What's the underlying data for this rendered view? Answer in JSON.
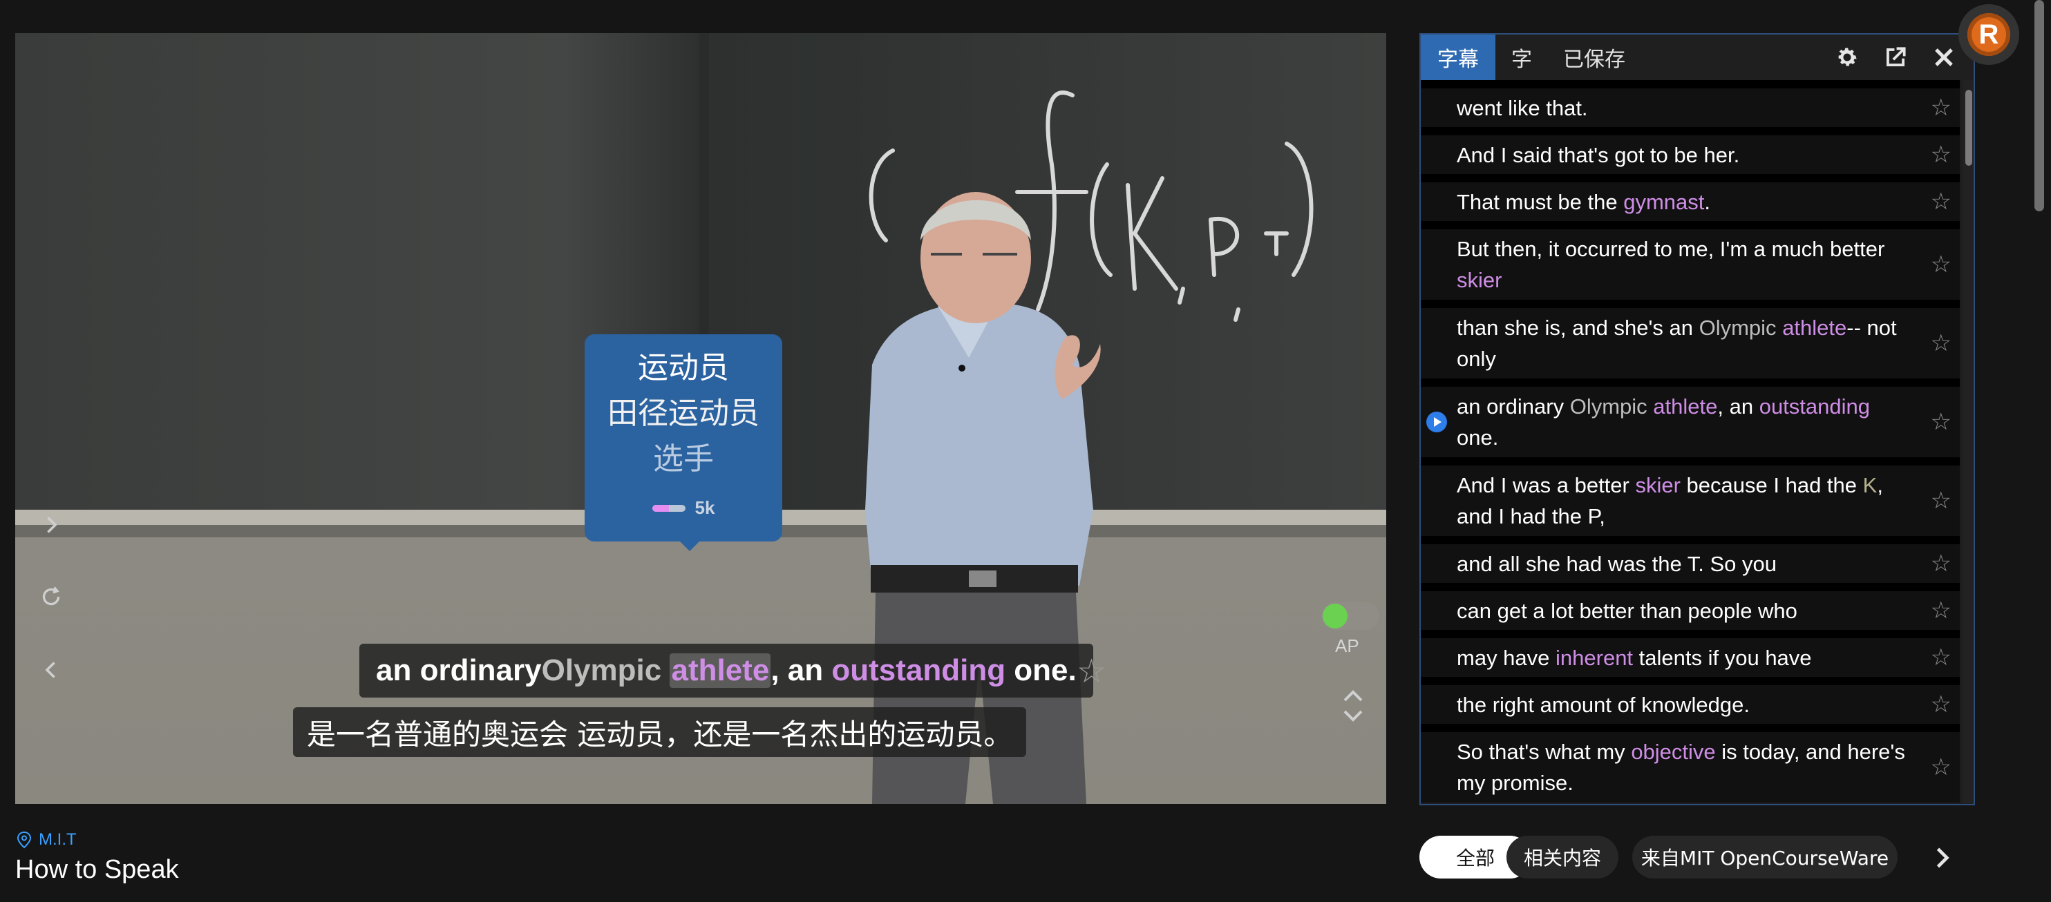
{
  "popup": {
    "line1": "运动员",
    "line2": "田径运动员",
    "line3": "选手",
    "frequency_label": "5k",
    "frequency_fill": 0.5
  },
  "caption_en": {
    "w1": "an ordinary ",
    "w2": "Olympic",
    "w3": " ",
    "w4": "athlete",
    "w5": ", an ",
    "w6": "outstanding",
    "w7": " one."
  },
  "caption_zh": "是一名普通的奥运会 运动员，还是一名杰出的运动员。",
  "star_glyph": "☆",
  "ap_label": "AP",
  "panel": {
    "tabs": [
      "字幕",
      "字",
      "已保存"
    ]
  },
  "subtitles": [
    {
      "segs": [
        {
          "t": "went like that.",
          "c": "w"
        }
      ]
    },
    {
      "segs": [
        {
          "t": "And I said that's got to be her.",
          "c": "w"
        }
      ]
    },
    {
      "segs": [
        {
          "t": "That must be the ",
          "c": "w"
        },
        {
          "t": "gymnast",
          "c": "p"
        },
        {
          "t": ".",
          "c": "w"
        }
      ]
    },
    {
      "segs": [
        {
          "t": "But then, it occurred to me, I'm a much better ",
          "c": "w"
        },
        {
          "t": "skier",
          "c": "p"
        }
      ]
    },
    {
      "segs": [
        {
          "t": "than she is, and she's an ",
          "c": "w"
        },
        {
          "t": "Olympic",
          "c": "g"
        },
        {
          "t": " ",
          "c": "w"
        },
        {
          "t": "athlete",
          "c": "p"
        },
        {
          "t": "-- not only",
          "c": "w"
        }
      ]
    },
    {
      "segs": [
        {
          "t": "an ordinary ",
          "c": "w"
        },
        {
          "t": "Olympic",
          "c": "g"
        },
        {
          "t": " ",
          "c": "w"
        },
        {
          "t": "athlete",
          "c": "p"
        },
        {
          "t": ", an ",
          "c": "w"
        },
        {
          "t": "outstanding",
          "c": "p"
        },
        {
          "t": " one.",
          "c": "w"
        }
      ],
      "active": true
    },
    {
      "segs": [
        {
          "t": "And I was a better ",
          "c": "w"
        },
        {
          "t": "skier",
          "c": "p"
        },
        {
          "t": " because I had the ",
          "c": "w"
        },
        {
          "t": "K",
          "c": "o"
        },
        {
          "t": ", and I had the P,",
          "c": "w"
        }
      ]
    },
    {
      "segs": [
        {
          "t": "and all she had was the T. So you",
          "c": "w"
        }
      ]
    },
    {
      "segs": [
        {
          "t": "can get a lot better than people who",
          "c": "w"
        }
      ]
    },
    {
      "segs": [
        {
          "t": "may have ",
          "c": "w"
        },
        {
          "t": "inherent",
          "c": "p"
        },
        {
          "t": " talents if you have",
          "c": "w"
        }
      ]
    },
    {
      "segs": [
        {
          "t": "the right amount of knowledge.",
          "c": "w"
        }
      ]
    },
    {
      "segs": [
        {
          "t": "So that's what my ",
          "c": "w"
        },
        {
          "t": "objective",
          "c": "p"
        },
        {
          "t": " is today, and here's my promise.",
          "c": "w"
        }
      ]
    }
  ],
  "avatar_letter": "R",
  "channel": "M.I.T",
  "video_title": "How to Speak",
  "chips": [
    "全部",
    "相关内容",
    "来自MIT OpenCourseWare"
  ],
  "colors": {
    "accent": "#2d6ab2",
    "highlight_purple": "#cf8ee6",
    "known_grey": "#bdbdbd",
    "link_blue": "#3aa0ff",
    "toggle_green": "#6ad151"
  }
}
